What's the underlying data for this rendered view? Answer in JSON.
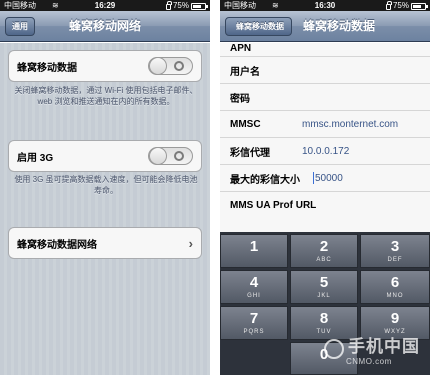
{
  "left": {
    "status": {
      "carrier": "中国移动",
      "wifi": "≋",
      "time": "16:29",
      "battery": "75%",
      "battery_level": 0.75
    },
    "nav": {
      "back": "通用",
      "title": "蜂窝移动网络"
    },
    "cellular_data": {
      "label": "蜂窝移动数据",
      "on": false
    },
    "cellular_note": "关闭蜂窝移动数据，通过 Wi-Fi 使用包括电子邮件、web 浏览和推送通知在内的所有数据。",
    "enable_3g": {
      "label": "启用 3G",
      "on": false
    },
    "enable_3g_note": "使用 3G 虽可提高数据载入速度，但可能会降低电池寿命。",
    "cellular_network": {
      "label": "蜂窝移动数据网络"
    }
  },
  "right": {
    "status": {
      "carrier": "中国移动",
      "wifi": "≋",
      "time": "16:30",
      "battery": "75%",
      "battery_level": 0.75
    },
    "nav": {
      "back": "蜂窝移动数据",
      "title": "蜂窝移动数据"
    },
    "rows": [
      {
        "key": "APN",
        "value": ""
      },
      {
        "key": "用户名",
        "value": ""
      },
      {
        "key": "密码",
        "value": ""
      },
      {
        "key": "MMSC",
        "value": "mmsc.monternet.com"
      },
      {
        "key": "彩信代理",
        "value": "10.0.0.172"
      },
      {
        "key": "最大的彩信大小",
        "value": "50000"
      },
      {
        "key": "MMS UA Prof URL",
        "value": ""
      }
    ],
    "keypad": [
      {
        "num": "1",
        "letters": ""
      },
      {
        "num": "2",
        "letters": "ABC"
      },
      {
        "num": "3",
        "letters": "DEF"
      },
      {
        "num": "4",
        "letters": "GHI"
      },
      {
        "num": "5",
        "letters": "JKL"
      },
      {
        "num": "6",
        "letters": "MNO"
      },
      {
        "num": "7",
        "letters": "PQRS"
      },
      {
        "num": "8",
        "letters": "TUV"
      },
      {
        "num": "9",
        "letters": "WXYZ"
      },
      {
        "num": "0",
        "letters": ""
      }
    ]
  },
  "watermark": {
    "cn": "手机中国",
    "en": "CNMO.com"
  }
}
